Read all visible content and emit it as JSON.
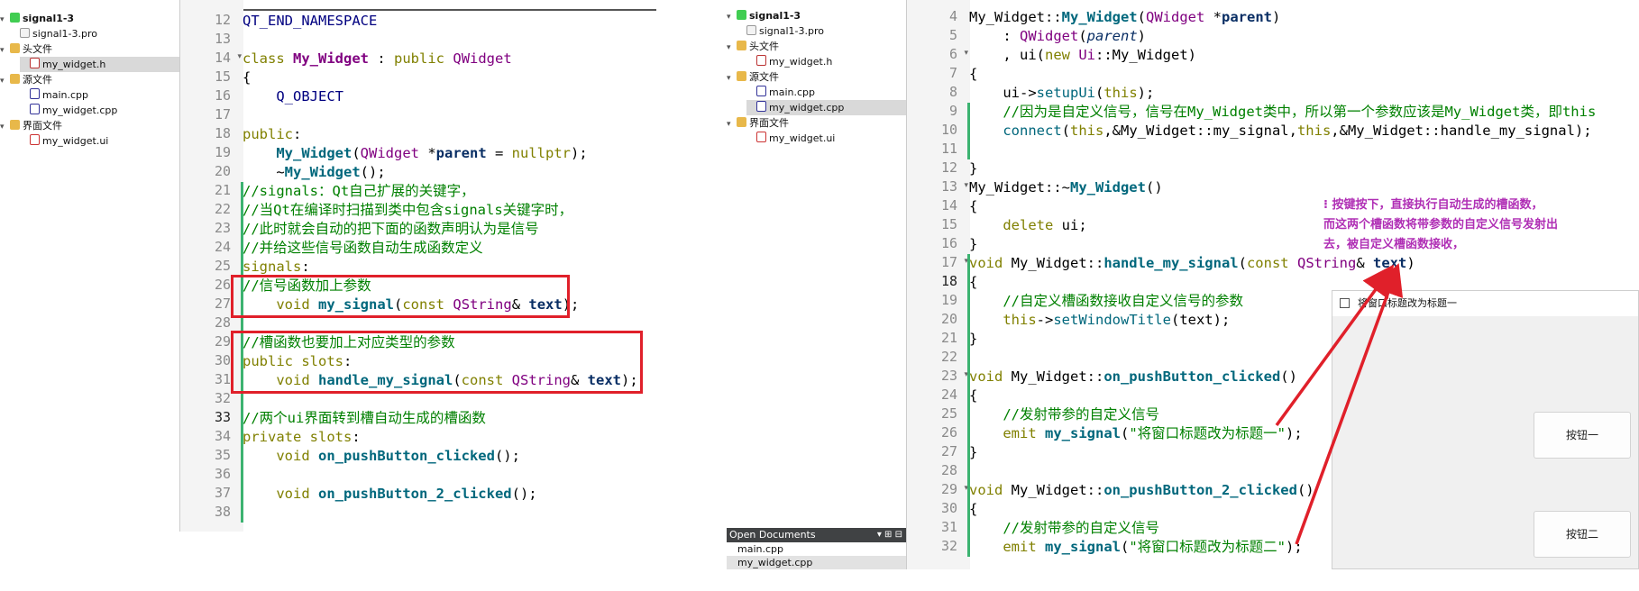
{
  "left": {
    "tree": [
      {
        "label": "signal1-3",
        "icon": "qt-project-icon",
        "bold": true,
        "arrow": "▾"
      },
      {
        "label": "signal1-3.pro",
        "icon": "pro-file-icon"
      },
      {
        "label": "头文件",
        "icon": "folder-icon",
        "arrow": "▾"
      },
      {
        "label": "my_widget.h",
        "icon": "header-file-icon",
        "selected": true
      },
      {
        "label": "源文件",
        "icon": "folder-icon",
        "arrow": "▾"
      },
      {
        "label": "main.cpp",
        "icon": "cpp-file-icon"
      },
      {
        "label": "my_widget.cpp",
        "icon": "cpp-file-icon"
      },
      {
        "label": "界面文件",
        "icon": "folder-icon",
        "arrow": "▾"
      },
      {
        "label": "my_widget.ui",
        "icon": "ui-file-icon"
      }
    ],
    "lines": [
      {
        "n": "12",
        "text": "QT_END_NAMESPACE"
      },
      {
        "n": "13",
        "text": ""
      },
      {
        "n": "14",
        "text": "class My_Widget : public QWidget"
      },
      {
        "n": "15",
        "text": "{"
      },
      {
        "n": "16",
        "text": "    Q_OBJECT"
      },
      {
        "n": "17",
        "text": ""
      },
      {
        "n": "18",
        "text": "public:"
      },
      {
        "n": "19",
        "text": "    My_Widget(QWidget *parent = nullptr);"
      },
      {
        "n": "20",
        "text": "    ~My_Widget();"
      },
      {
        "n": "21",
        "text": "//signals：Qt自己扩展的关键字，"
      },
      {
        "n": "22",
        "text": "//当Qt在编译时扫描到类中包含signals关键字时，"
      },
      {
        "n": "23",
        "text": "//此时就会自动的把下面的函数声明认为是信号"
      },
      {
        "n": "24",
        "text": "//并给这些信号函数自动生成函数定义"
      },
      {
        "n": "25",
        "text": "signals:"
      },
      {
        "n": "26",
        "text": "//信号函数加上参数"
      },
      {
        "n": "27",
        "text": "    void my_signal(const QString& text);"
      },
      {
        "n": "28",
        "text": ""
      },
      {
        "n": "29",
        "text": "//槽函数也要加上对应类型的参数"
      },
      {
        "n": "30",
        "text": "public slots:"
      },
      {
        "n": "31",
        "text": "    void handle_my_signal(const QString& text);"
      },
      {
        "n": "32",
        "text": ""
      },
      {
        "n": "33",
        "text": "//两个ui界面转到槽自动生成的槽函数"
      },
      {
        "n": "34",
        "text": "private slots:"
      },
      {
        "n": "35",
        "text": "    void on_pushButton_clicked();"
      },
      {
        "n": "36",
        "text": ""
      },
      {
        "n": "37",
        "text": "    void on_pushButton_2_clicked();"
      },
      {
        "n": "38",
        "text": ""
      }
    ]
  },
  "right": {
    "tree": [
      {
        "label": "signal1-3",
        "icon": "qt-project-icon",
        "bold": true,
        "arrow": "▾"
      },
      {
        "label": "signal1-3.pro",
        "icon": "pro-file-icon"
      },
      {
        "label": "头文件",
        "icon": "folder-icon",
        "arrow": "▾"
      },
      {
        "label": "my_widget.h",
        "icon": "header-file-icon"
      },
      {
        "label": "源文件",
        "icon": "folder-icon",
        "arrow": "▾"
      },
      {
        "label": "main.cpp",
        "icon": "cpp-file-icon"
      },
      {
        "label": "my_widget.cpp",
        "icon": "cpp-file-icon",
        "selected": true
      },
      {
        "label": "界面文件",
        "icon": "folder-icon",
        "arrow": "▾"
      },
      {
        "label": "my_widget.ui",
        "icon": "ui-file-icon"
      }
    ],
    "lines": [
      {
        "n": "4",
        "text": "My_Widget::My_Widget(QWidget *parent)"
      },
      {
        "n": "5",
        "text": "    : QWidget(parent)"
      },
      {
        "n": "6",
        "text": "    , ui(new Ui::My_Widget)"
      },
      {
        "n": "7",
        "text": "{"
      },
      {
        "n": "8",
        "text": "    ui->setupUi(this);"
      },
      {
        "n": "9",
        "text": "    //因为是自定义信号，信号在My_Widget类中，所以第一个参数应该是My_Widget类，即this"
      },
      {
        "n": "10",
        "text": "    connect(this,&My_Widget::my_signal,this,&My_Widget::handle_my_signal);"
      },
      {
        "n": "11",
        "text": ""
      },
      {
        "n": "12",
        "text": "}"
      },
      {
        "n": "13",
        "text": "My_Widget::~My_Widget()"
      },
      {
        "n": "14",
        "text": "{"
      },
      {
        "n": "15",
        "text": "    delete ui;"
      },
      {
        "n": "16",
        "text": "}"
      },
      {
        "n": "17",
        "text": "void My_Widget::handle_my_signal(const QString& text)"
      },
      {
        "n": "18",
        "text": "{"
      },
      {
        "n": "19",
        "text": "    //自定义槽函数接收自定义信号的参数"
      },
      {
        "n": "20",
        "text": "    this->setWindowTitle(text);"
      },
      {
        "n": "21",
        "text": "}"
      },
      {
        "n": "22",
        "text": ""
      },
      {
        "n": "23",
        "text": "void My_Widget::on_pushButton_clicked()"
      },
      {
        "n": "24",
        "text": "{"
      },
      {
        "n": "25",
        "text": "    //发射带参的自定义信号"
      },
      {
        "n": "26",
        "text": "    emit my_signal(\"将窗口标题改为标题一\");"
      },
      {
        "n": "27",
        "text": "}"
      },
      {
        "n": "28",
        "text": ""
      },
      {
        "n": "29",
        "text": "void My_Widget::on_pushButton_2_clicked()"
      },
      {
        "n": "30",
        "text": "{"
      },
      {
        "n": "31",
        "text": "    //发射带参的自定义信号"
      },
      {
        "n": "32",
        "text": "    emit my_signal(\"将窗口标题改为标题二\");"
      }
    ],
    "open_documents": {
      "title": "Open Documents",
      "items": [
        {
          "label": "main.cpp"
        },
        {
          "label": "my_widget.cpp",
          "selected": true
        }
      ]
    }
  },
  "annotation": {
    "lines": [
      "⁝      按键按下，直接执行自动生成的槽函数，",
      "而这两个槽函数将带参数的自定义信号发射出",
      "去，被自定义槽函数接收，"
    ],
    "color": "#b02fb5"
  },
  "app_window": {
    "title": "将窗口标题改为标题一",
    "button1": "按钮一",
    "button2": "按钮二"
  },
  "colors": {
    "highlight_box": "#e0202a",
    "arrow": "#e0202a",
    "keyword": "#808000",
    "type": "#800080",
    "comment": "#008000"
  }
}
